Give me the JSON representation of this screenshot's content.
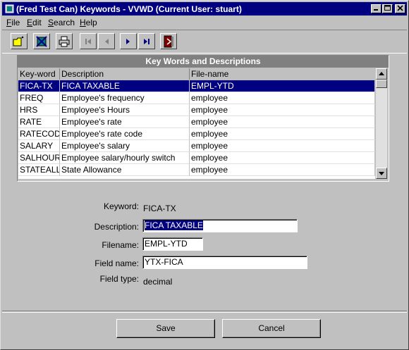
{
  "window": {
    "title": "(Fred Test Can) Keywords - VVWD (Current User: stuart)"
  },
  "menu": [
    {
      "accel": "F",
      "rest": "ile"
    },
    {
      "accel": "E",
      "rest": "dit"
    },
    {
      "accel": "S",
      "rest": "earch"
    },
    {
      "accel": "H",
      "rest": "elp"
    }
  ],
  "toolbar": {
    "icons": [
      "new-folder-icon",
      "delete-icon",
      "print-icon",
      "first-record-icon",
      "previous-record-icon",
      "next-record-icon",
      "last-record-icon",
      "exit-icon"
    ]
  },
  "grid": {
    "title": "Key Words and Descriptions",
    "columns": [
      "Key-word",
      "Description",
      "File-name"
    ],
    "rows": [
      [
        "FICA-TX",
        "FICA TAXABLE",
        "EMPL-YTD"
      ],
      [
        "FREQ",
        "Employee's frequency",
        "employee"
      ],
      [
        "HRS",
        "Employee's Hours",
        "employee"
      ],
      [
        "RATE",
        "Employee's rate",
        "employee"
      ],
      [
        "RATECOD",
        "Employee's rate code",
        "employee"
      ],
      [
        "SALARY",
        "Employee's salary",
        "employee"
      ],
      [
        "SALHOUR",
        "Employee salary/hourly switch",
        "employee"
      ],
      [
        "STATEALL",
        "State Allowance",
        "employee"
      ]
    ],
    "selected_row": 0
  },
  "form": {
    "keyword_label": "Keyword:",
    "keyword_value": "FICA-TX",
    "description_label": "Description:",
    "description_value": "FICA TAXABLE",
    "filename_label": "Filename:",
    "filename_value": "EMPL-YTD",
    "fieldname_label": "Field name:",
    "fieldname_value": "YTX-FICA",
    "fieldtype_label": "Field type:",
    "fieldtype_value": "decimal"
  },
  "buttons": {
    "save": "Save",
    "cancel": "Cancel"
  },
  "colors": {
    "titlebar": "#000080",
    "face": "#c0c0c0",
    "selection": "#000080"
  }
}
